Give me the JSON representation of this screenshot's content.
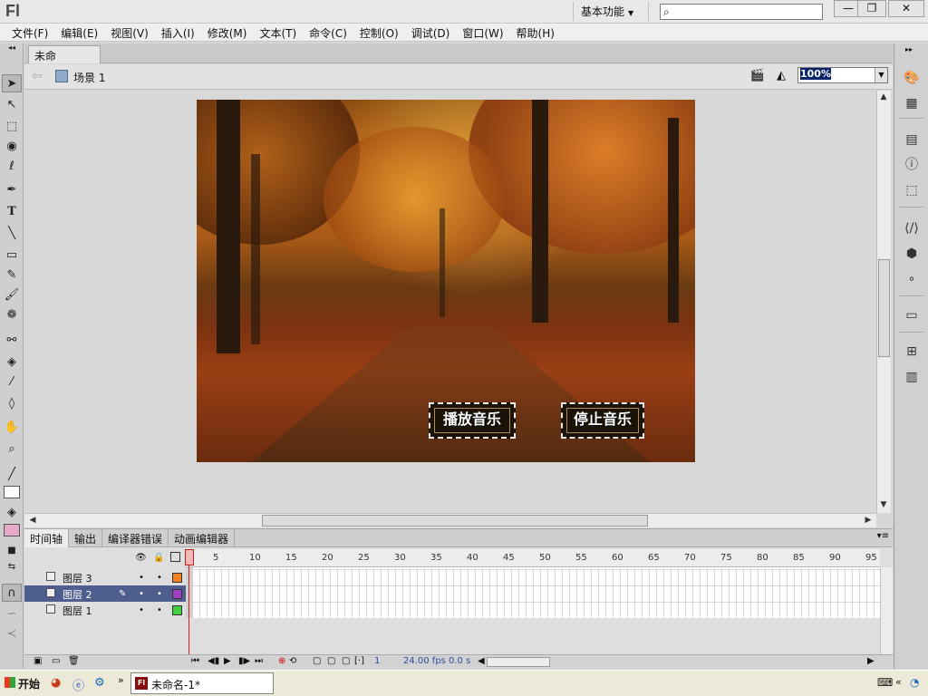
{
  "app": {
    "logo": "Fl",
    "workspace": "基本功能",
    "search_placeholder": ""
  },
  "window_controls": {
    "minimize": "—",
    "restore": "❐",
    "close": "✕"
  },
  "menu": [
    "文件(F)",
    "编辑(E)",
    "视图(V)",
    "插入(I)",
    "修改(M)",
    "文本(T)",
    "命令(C)",
    "控制(O)",
    "调试(D)",
    "窗口(W)",
    "帮助(H)"
  ],
  "document": {
    "tab_title": "未命名-1*",
    "close": "×"
  },
  "editbar": {
    "back": "⇦",
    "scene": "场景 1",
    "zoom": "100%"
  },
  "stage": {
    "buttons": [
      {
        "label": "播放音乐"
      },
      {
        "label": "停止音乐"
      }
    ],
    "colors": {
      "frame": "#e8e8e8",
      "button_bg": "#1b1208"
    }
  },
  "timeline": {
    "tabs": [
      "时间轴",
      "输出",
      "编译器错误",
      "动画编辑器"
    ],
    "active_tab": "时间轴",
    "frame_numbers": [
      "1",
      "5",
      "10",
      "15",
      "20",
      "25",
      "30",
      "35",
      "40",
      "45",
      "50",
      "55",
      "60",
      "65",
      "70",
      "75",
      "80",
      "85",
      "90",
      "95"
    ],
    "layers": [
      {
        "name": "图层 3",
        "color": "#f08020",
        "selected": false
      },
      {
        "name": "图层 2",
        "color": "#a040c0",
        "selected": true
      },
      {
        "name": "图层 1",
        "color": "#40d040",
        "selected": false
      }
    ],
    "status": {
      "current_frame": "1",
      "fps": "24.00 fps",
      "time": "0.0 s"
    }
  },
  "taskbar": {
    "start": "开始",
    "task_item": "未命名-1*"
  }
}
